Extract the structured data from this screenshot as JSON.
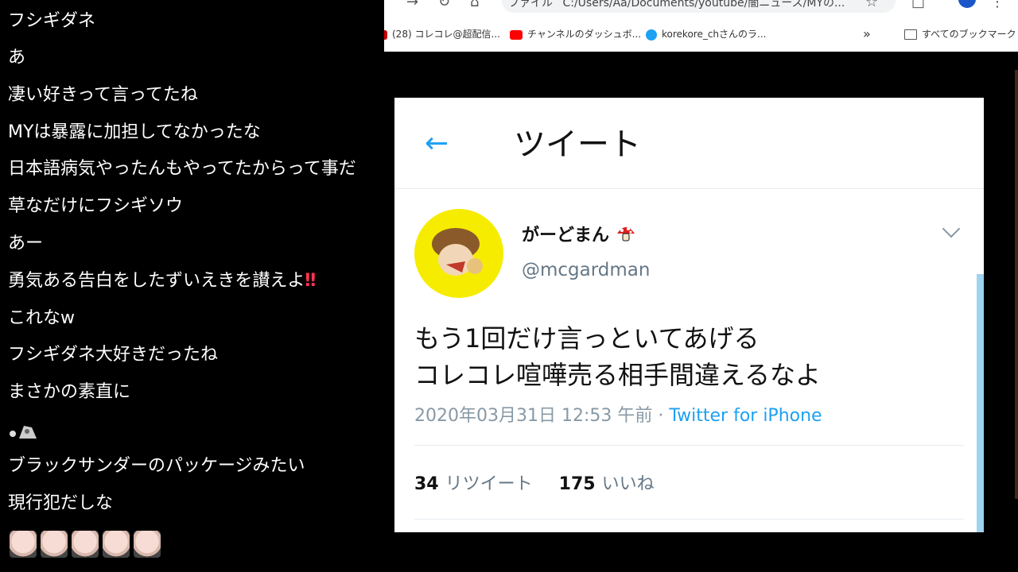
{
  "chat": {
    "messages": [
      "フシギダネ",
      "あ",
      "凄い好きって言ってたね",
      "MYは暴露に加担してなかったな",
      "日本語病気やったんもやってたからって事だ",
      "草なだけにフシギソウ",
      "あー",
      "勇気ある告白をしたずいえきを讃えよ",
      "これなw",
      "フシギダネ大好きだったね",
      "まさかの素直に",
      "",
      "ブラックサンダーのパッケージみたい",
      "現行犯だしな"
    ],
    "exclaim": "‼"
  },
  "browser": {
    "address": "C:/Users/Aa/Documents/youtube/闇ニュース/MYの...",
    "file_label": "ファイル",
    "bookmarks": [
      {
        "label": "(28) コレコレ@超配信...",
        "color": "#cc0000"
      },
      {
        "label": "チャンネルのダッシュボ...",
        "color": "#ff0000"
      },
      {
        "label": "korekore_chさんのラ...",
        "color": "#1da1f2"
      }
    ],
    "all_bookmarks": "すべてのブックマーク",
    "overflow": "»"
  },
  "tweet": {
    "header_title": "ツイート",
    "back_arrow": "←",
    "display_name": "がーどまん",
    "handle": "@mcgardman",
    "text_line1": "もう1回だけ言っといてあげる",
    "text_line2": "コレコレ喧嘩売る相手間違えるなよ",
    "timestamp": "2020年03月31日 12:53 午前 · ",
    "source": "Twitter for iPhone",
    "retweets_count": "34",
    "retweets_label": "リツイート",
    "likes_count": "175",
    "likes_label": "いいね",
    "accent": "#1da1f2"
  }
}
